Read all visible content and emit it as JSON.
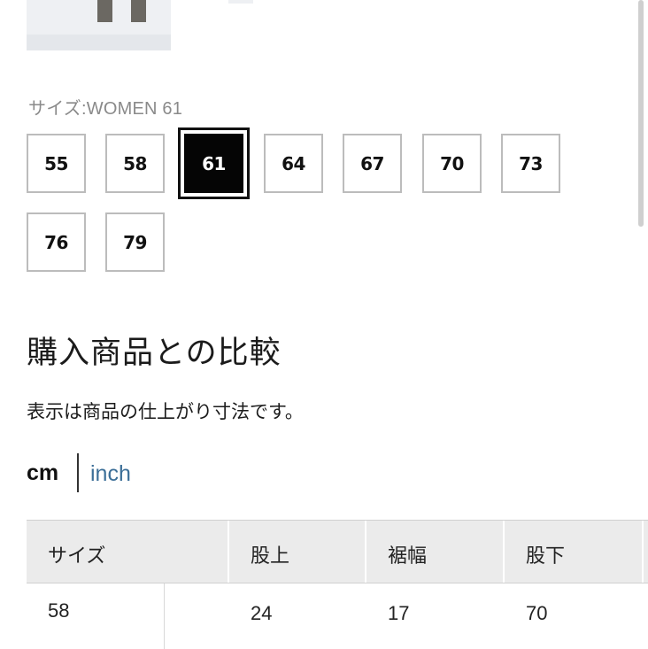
{
  "size_selector": {
    "label": "サイズ:WOMEN 61",
    "sizes": [
      "55",
      "58",
      "61",
      "64",
      "67",
      "70",
      "73",
      "76",
      "79"
    ],
    "selected": "61"
  },
  "comparison": {
    "heading": "購入商品との比較",
    "note": "表示は商品の仕上がり寸法です。"
  },
  "units": {
    "cm": "cm",
    "inch": "inch",
    "active": "cm"
  },
  "table": {
    "headers": [
      "サイズ",
      "股上",
      "裾幅",
      "股下"
    ],
    "rows": [
      [
        "58",
        "24",
        "17",
        "70"
      ]
    ]
  }
}
